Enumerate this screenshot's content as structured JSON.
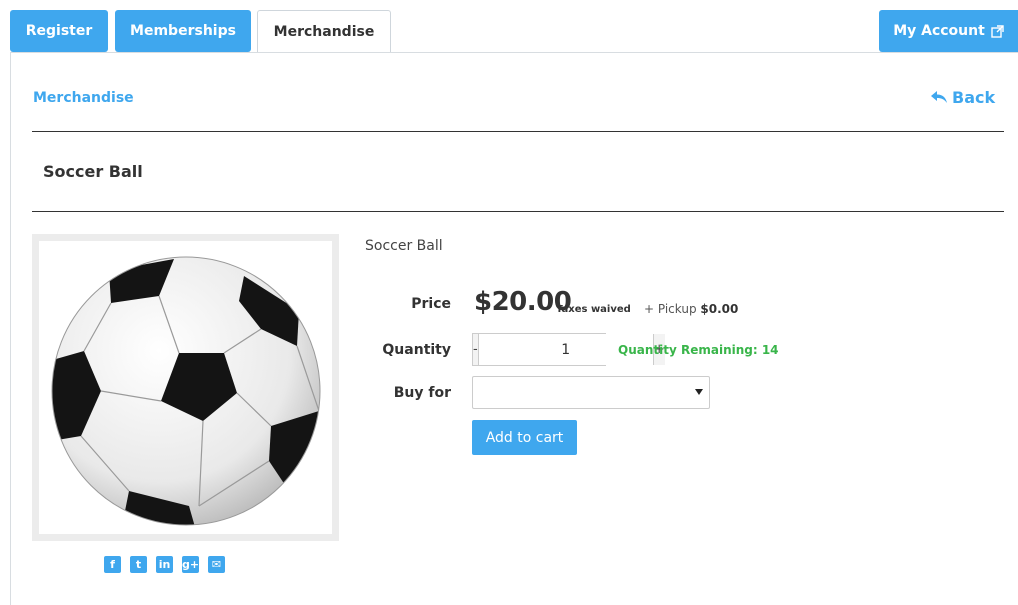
{
  "nav": {
    "tabs": [
      "Register",
      "Memberships",
      "Merchandise"
    ],
    "account_label": "My Account",
    "accent_color": "#3fa7ee"
  },
  "breadcrumb": "Merchandise",
  "back_label": "Back",
  "page_title": "Soccer Ball",
  "product": {
    "name": "Soccer Ball",
    "price_label": "Price",
    "price": "$20.00",
    "tax_note": "Taxes waived",
    "pickup_prefix": "+ Pickup",
    "pickup_price": "$0.00",
    "quantity_label": "Quantity",
    "quantity_value": "1",
    "quantity_remaining": "Quantity Remaining: 14",
    "buy_for_label": "Buy for",
    "buy_for_value": "",
    "add_to_cart": "Add to cart"
  },
  "social": [
    {
      "icon": "facebook-icon",
      "glyph": "f"
    },
    {
      "icon": "twitter-icon",
      "glyph": "t"
    },
    {
      "icon": "linkedin-icon",
      "glyph": "in"
    },
    {
      "icon": "google-plus-icon",
      "glyph": "g+"
    },
    {
      "icon": "email-icon",
      "glyph": "✉"
    }
  ]
}
